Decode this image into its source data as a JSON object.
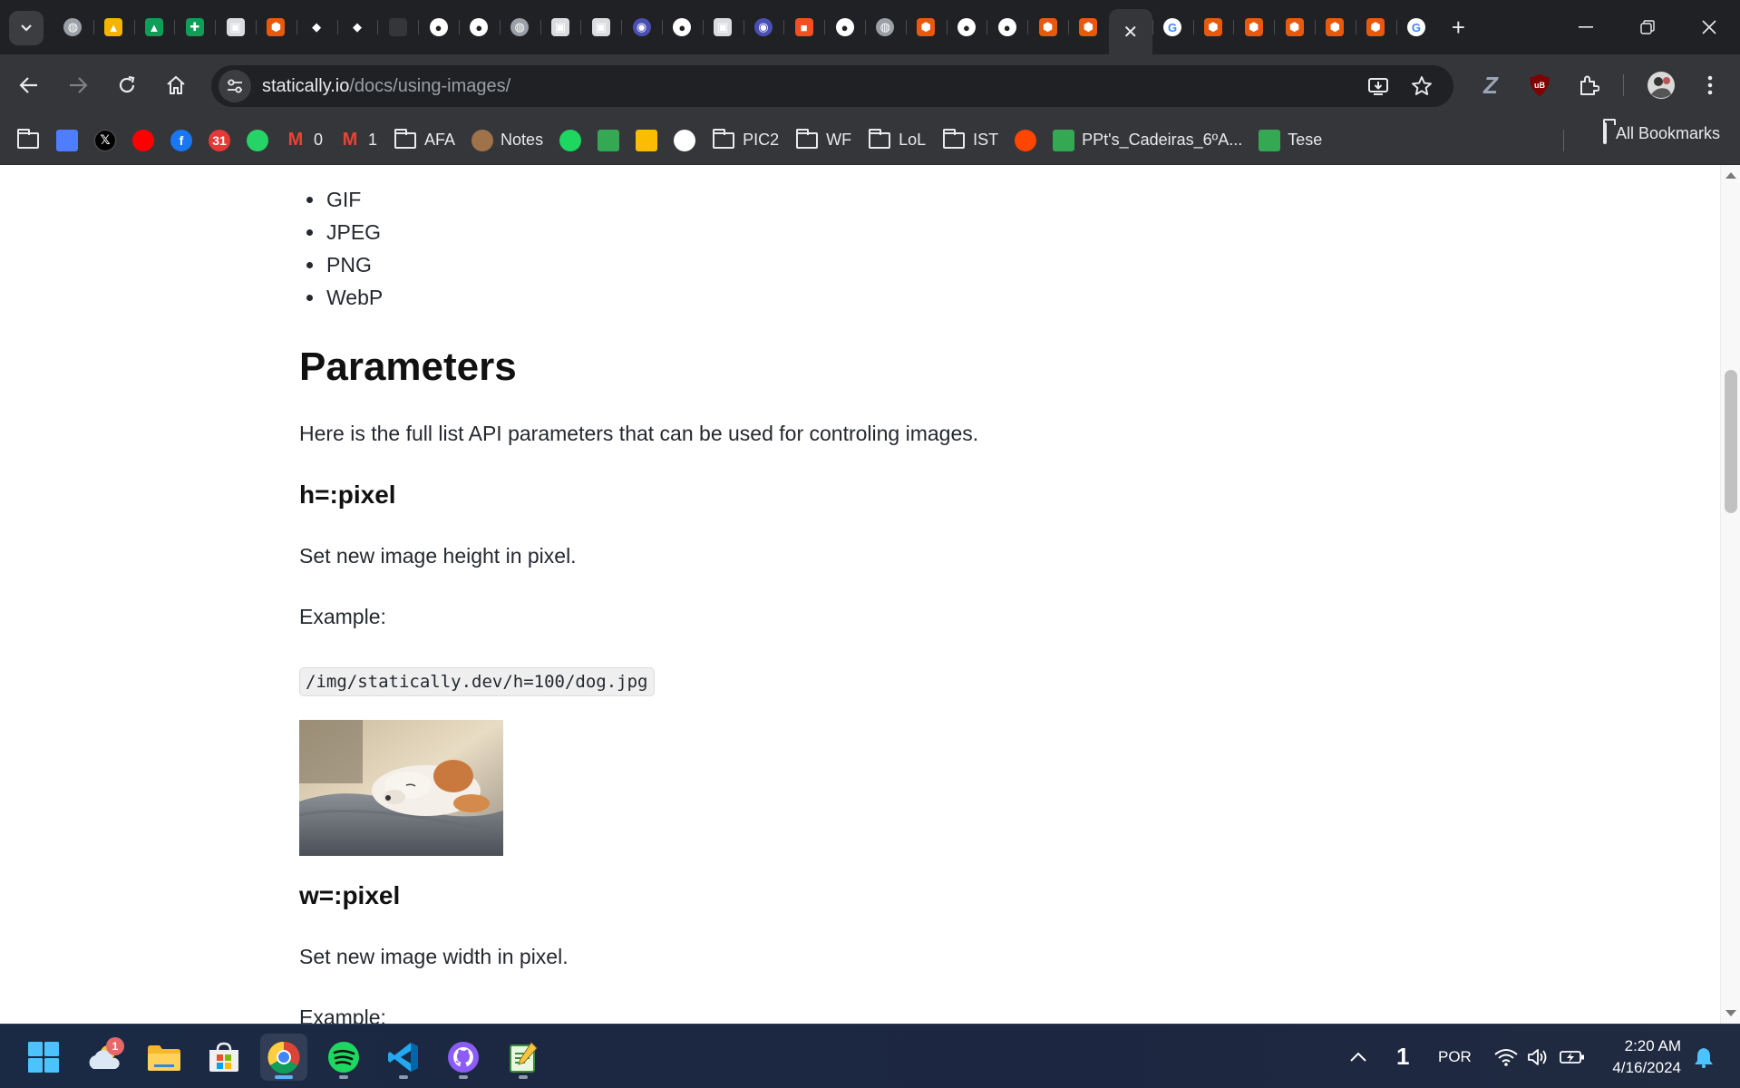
{
  "browser": {
    "tab_count_favicons": 36,
    "active_tab_close": "✕",
    "new_tab": "+",
    "window_controls": {
      "minimize": "—",
      "restore": "❐",
      "close": "✕"
    }
  },
  "toolbar": {
    "url_host": "statically.io",
    "url_path": "/docs/using-images/",
    "extension_label_z": "Z",
    "extension_label_ub": "uB"
  },
  "bookmarks": {
    "items": [
      {
        "label": "",
        "icon": "folder-icon"
      },
      {
        "label": "",
        "icon": "bars-icon"
      },
      {
        "label": "",
        "icon": "x-icon",
        "glyph": "𝕏"
      },
      {
        "label": "",
        "icon": "youtube-icon"
      },
      {
        "label": "",
        "icon": "facebook-icon",
        "glyph": "f"
      },
      {
        "label": "",
        "icon": "calendar-icon",
        "glyph": "31"
      },
      {
        "label": "",
        "icon": "whatsapp-icon"
      },
      {
        "label": "0",
        "icon": "gmail-icon",
        "glyph": "M"
      },
      {
        "label": "1",
        "icon": "gmail-icon",
        "glyph": "M"
      },
      {
        "label": "AFA",
        "icon": "folder-icon"
      },
      {
        "label": "Notes",
        "icon": "notes-icon"
      },
      {
        "label": "",
        "icon": "spotify-icon"
      },
      {
        "label": "",
        "icon": "drive-icon"
      },
      {
        "label": "",
        "icon": "photos-icon"
      },
      {
        "label": "",
        "icon": "github-icon"
      },
      {
        "label": "PIC2",
        "icon": "folder-icon"
      },
      {
        "label": "WF",
        "icon": "folder-icon"
      },
      {
        "label": "LoL",
        "icon": "folder-icon"
      },
      {
        "label": "IST",
        "icon": "folder-icon"
      },
      {
        "label": "",
        "icon": "reddit-icon"
      },
      {
        "label": "PPt's_Cadeiras_6ºA...",
        "icon": "drive-icon"
      },
      {
        "label": "Tese",
        "icon": "drive-icon"
      }
    ],
    "all_bookmarks": "All Bookmarks"
  },
  "page": {
    "formats": [
      "GIF",
      "JPEG",
      "PNG",
      "WebP"
    ],
    "parameters_heading": "Parameters",
    "intro": "Here is the full list API parameters that can be used for controling images.",
    "h_param": "h=:pixel",
    "h_desc": "Set new image height in pixel.",
    "example_label": "Example:",
    "example_code": "/img/statically.dev/h=100/dog.jpg",
    "w_param": "w=:pixel",
    "w_desc": "Set new image width in pixel.",
    "example_label_2": "Example:"
  },
  "taskbar": {
    "weather_badge": "1",
    "tray_number": "1",
    "language": "POR",
    "time": "2:20 AM",
    "date": "4/16/2024"
  },
  "colors": {
    "chrome_dark": "#202124",
    "chrome_toolbar": "#35363a",
    "taskbar": "#1b2a44"
  }
}
